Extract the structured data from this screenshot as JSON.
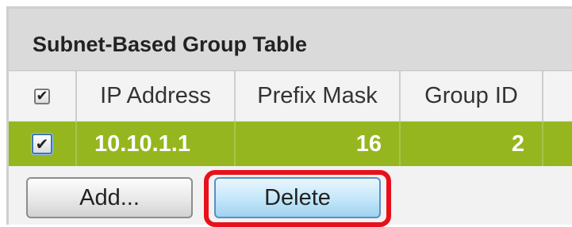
{
  "table": {
    "title": "Subnet-Based Group Table",
    "columns": [
      "IP Address",
      "Prefix Mask",
      "Group ID"
    ],
    "rows": [
      {
        "selected": true,
        "ip_address": "10.10.1.1",
        "prefix_mask": "16",
        "group_id": "2"
      }
    ]
  },
  "buttons": {
    "add_label": "Add...",
    "delete_label": "Delete",
    "highlighted": "Delete"
  },
  "checkmark_glyph": "✔",
  "colors": {
    "selected_row": "#95b61f",
    "highlight_ring": "#e8101a",
    "delete_button": "#c6e8fa"
  }
}
